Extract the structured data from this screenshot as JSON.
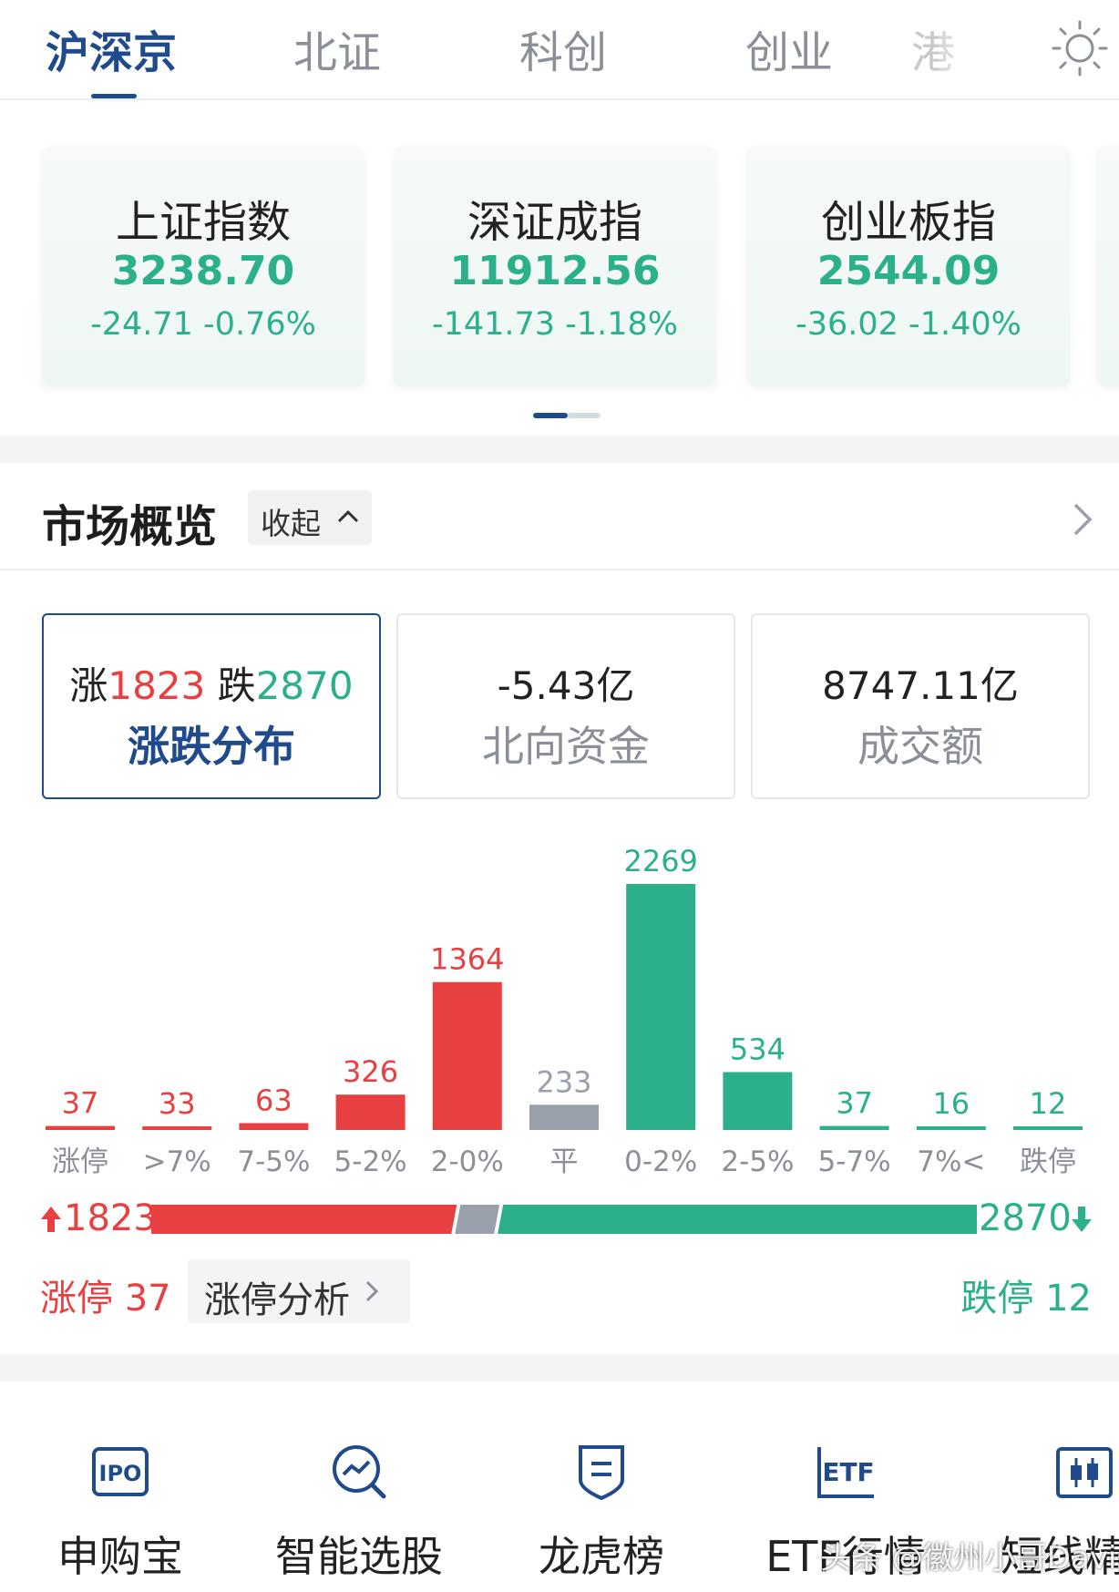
{
  "tabs": [
    {
      "label": "沪深京",
      "active": true
    },
    {
      "label": "北证",
      "active": false
    },
    {
      "label": "科创",
      "active": false
    },
    {
      "label": "创业",
      "active": false
    },
    {
      "label": "港",
      "active": false
    }
  ],
  "theme_icon": "sun-icon",
  "indices": [
    {
      "name": "上证指数",
      "value": "3238.70",
      "change": "-24.71 -0.76%"
    },
    {
      "name": "深证成指",
      "value": "11912.56",
      "change": "-141.73 -1.18%"
    },
    {
      "name": "创业板指",
      "value": "2544.09",
      "change": "-36.02 -1.40%"
    }
  ],
  "market": {
    "title": "市场概览",
    "collapse_label": "收起",
    "cards": [
      {
        "up_label": "涨",
        "up_value": "1823",
        "down_label": "跌",
        "down_value": "2870",
        "label": "涨跌分布"
      },
      {
        "value": "-5.43亿",
        "label": "北向资金"
      },
      {
        "value": "8747.11亿",
        "label": "成交额"
      }
    ]
  },
  "chart_data": {
    "type": "bar",
    "categories": [
      "涨停",
      ">7%",
      "7-5%",
      "5-2%",
      "2-0%",
      "平",
      "0-2%",
      "2-5%",
      "5-7%",
      "7%<",
      "跌停"
    ],
    "values": [
      37,
      33,
      63,
      326,
      1364,
      233,
      2269,
      534,
      37,
      16,
      12
    ],
    "value_labels": [
      "37",
      "33",
      "63",
      "326",
      "1364",
      "233",
      "2269",
      "534",
      "37",
      "16",
      "12"
    ],
    "directions": [
      "up",
      "up",
      "up",
      "up",
      "up",
      "flat",
      "down",
      "down",
      "down",
      "down",
      "down"
    ],
    "colors": {
      "up": "#e84040",
      "flat": "#9aa0ab",
      "down": "#2bb08b"
    }
  },
  "ratio": {
    "up_total": 1823,
    "down_total": 2870,
    "up_label": "1823",
    "down_label": "2870",
    "flat_total": 233
  },
  "limit": {
    "up_text": "涨停 37",
    "analysis_label": "涨停分析",
    "down_text": "跌停 12"
  },
  "tools": [
    {
      "label": "申购宝",
      "icon": "ipo-icon"
    },
    {
      "label": "智能选股",
      "icon": "smart-pick-icon"
    },
    {
      "label": "龙虎榜",
      "icon": "dragon-tiger-icon"
    },
    {
      "label": "ETF行情",
      "icon": "etf-icon"
    },
    {
      "label": "短线精灵",
      "icon": "short-term-icon"
    }
  ],
  "watermark": "头条 @徽州小哥Davis"
}
